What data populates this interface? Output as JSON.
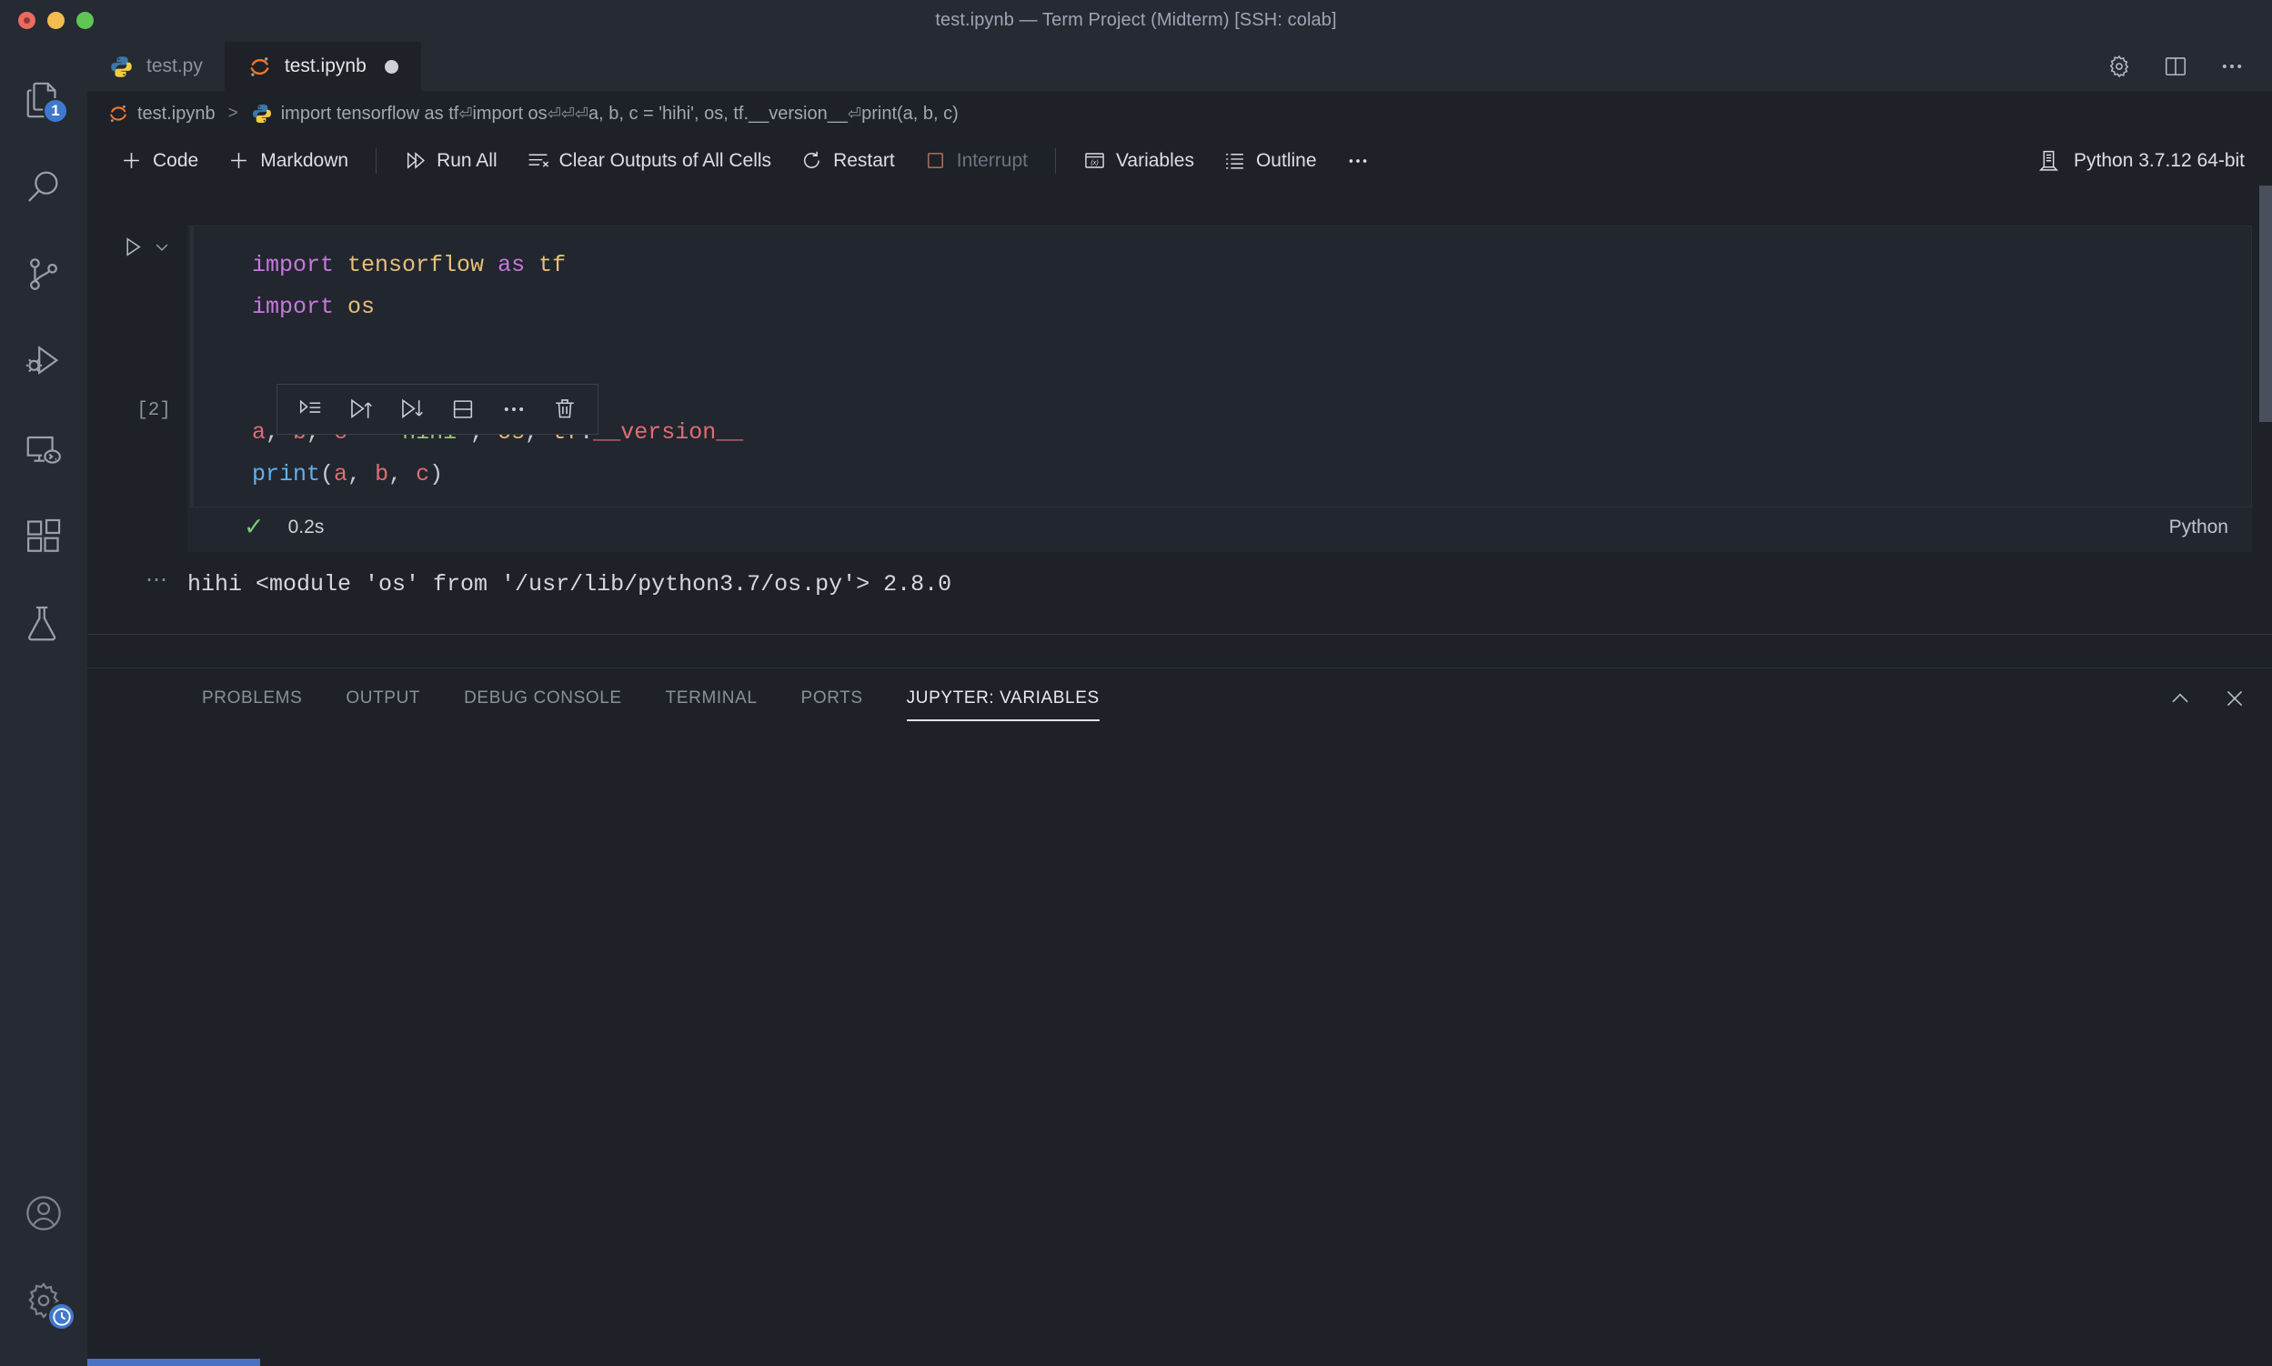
{
  "window": {
    "title": "test.ipynb — Term Project (Midterm) [SSH: colab]"
  },
  "activitybar": {
    "items": [
      {
        "name": "explorer",
        "icon": "files-icon",
        "badge": "1"
      },
      {
        "name": "search",
        "icon": "search-icon",
        "badge": ""
      },
      {
        "name": "source-control",
        "icon": "source-control-icon",
        "badge": ""
      },
      {
        "name": "run-and-debug",
        "icon": "debug-icon",
        "badge": ""
      },
      {
        "name": "remote-explorer",
        "icon": "remote-explorer-icon",
        "badge": ""
      },
      {
        "name": "extensions",
        "icon": "extensions-icon",
        "badge": ""
      },
      {
        "name": "testing",
        "icon": "beaker-icon",
        "badge": ""
      }
    ],
    "bottom": [
      {
        "name": "accounts",
        "icon": "account-icon"
      },
      {
        "name": "manage",
        "icon": "gear-icon",
        "badge_icon": "clock-icon"
      }
    ]
  },
  "tabs": [
    {
      "label": "test.py",
      "icon": "python-file-icon",
      "active": false,
      "dirty": false
    },
    {
      "label": "test.ipynb",
      "icon": "jupyter-file-icon",
      "active": true,
      "dirty": true
    }
  ],
  "tabbar_actions": [
    {
      "name": "notebook-settings",
      "icon": "gear-icon"
    },
    {
      "name": "split-editor",
      "icon": "split-editor-icon"
    },
    {
      "name": "more-actions",
      "icon": "ellipsis-icon"
    }
  ],
  "breadcrumb": {
    "file": "test.ipynb",
    "separator": ">",
    "cell_summary_parts": [
      "import tensorflow as tf",
      "import os",
      "",
      "",
      "a, b, c = 'hihi', os, tf.__version__",
      "print(a, b, c)"
    ],
    "return_glyph": "⏎"
  },
  "notebook_toolbar": {
    "buttons": [
      {
        "label": "Code",
        "icon": "plus-icon",
        "disabled": false
      },
      {
        "label": "Markdown",
        "icon": "plus-icon",
        "disabled": false
      },
      {
        "label": "Run All",
        "icon": "run-all-icon",
        "disabled": false
      },
      {
        "label": "Clear Outputs of All Cells",
        "icon": "clear-outputs-icon",
        "disabled": false
      },
      {
        "label": "Restart",
        "icon": "restart-icon",
        "disabled": false
      },
      {
        "label": "Interrupt",
        "icon": "stop-square-icon",
        "disabled": true
      },
      {
        "label": "Variables",
        "icon": "variables-icon",
        "disabled": false
      },
      {
        "label": "Outline",
        "icon": "outline-icon",
        "disabled": false
      },
      {
        "label": "…",
        "icon": "ellipsis-icon",
        "disabled": false
      }
    ],
    "kernel": {
      "label": "Python 3.7.12 64-bit",
      "icon": "kernel-icon"
    }
  },
  "cell_toolbar": {
    "buttons": [
      {
        "name": "run-by-line",
        "icon": "run-by-line-icon"
      },
      {
        "name": "run-above",
        "icon": "run-above-icon"
      },
      {
        "name": "run-below",
        "icon": "run-below-icon"
      },
      {
        "name": "split-cell",
        "icon": "split-cell-icon"
      },
      {
        "name": "more",
        "icon": "ellipsis-icon"
      },
      {
        "name": "delete-cell",
        "icon": "trash-icon"
      }
    ]
  },
  "cell": {
    "execution_count": "[2]",
    "run_icon": "play-icon",
    "collapse_icon": "chevron-down-icon",
    "status_icon": "check-icon",
    "elapsed": "0.2s",
    "language": "Python",
    "code_lines": [
      [
        {
          "t": "import",
          "c": "kw"
        },
        {
          "t": " ",
          "c": "pl"
        },
        {
          "t": "tensorflow",
          "c": "mod"
        },
        {
          "t": " ",
          "c": "pl"
        },
        {
          "t": "as",
          "c": "kw"
        },
        {
          "t": " ",
          "c": "pl"
        },
        {
          "t": "tf",
          "c": "mod"
        }
      ],
      [
        {
          "t": "import",
          "c": "kw"
        },
        {
          "t": " ",
          "c": "pl"
        },
        {
          "t": "os",
          "c": "mod"
        }
      ],
      [],
      [],
      [
        {
          "t": "a",
          "c": "var"
        },
        {
          "t": ", ",
          "c": "pl"
        },
        {
          "t": "b",
          "c": "var"
        },
        {
          "t": ", ",
          "c": "pl"
        },
        {
          "t": "c",
          "c": "var"
        },
        {
          "t": " ",
          "c": "pl"
        },
        {
          "t": "=",
          "c": "op"
        },
        {
          "t": " ",
          "c": "pl"
        },
        {
          "t": "'hihi'",
          "c": "str"
        },
        {
          "t": ", ",
          "c": "pl"
        },
        {
          "t": "os",
          "c": "mod"
        },
        {
          "t": ", ",
          "c": "pl"
        },
        {
          "t": "tf",
          "c": "mod"
        },
        {
          "t": ".",
          "c": "pl"
        },
        {
          "t": "__version__",
          "c": "var"
        }
      ],
      [
        {
          "t": "print",
          "c": "fn"
        },
        {
          "t": "(",
          "c": "pl"
        },
        {
          "t": "a",
          "c": "var"
        },
        {
          "t": ", ",
          "c": "pl"
        },
        {
          "t": "b",
          "c": "var"
        },
        {
          "t": ", ",
          "c": "pl"
        },
        {
          "t": "c",
          "c": "var"
        },
        {
          "t": ")",
          "c": "pl"
        }
      ]
    ],
    "output_dots": "⋯",
    "output_text": "hihi <module 'os' from '/usr/lib/python3.7/os.py'> 2.8.0"
  },
  "panel": {
    "tabs": [
      {
        "label": "PROBLEMS",
        "active": false
      },
      {
        "label": "OUTPUT",
        "active": false
      },
      {
        "label": "DEBUG CONSOLE",
        "active": false
      },
      {
        "label": "TERMINAL",
        "active": false
      },
      {
        "label": "PORTS",
        "active": false
      },
      {
        "label": "JUPYTER: VARIABLES",
        "active": true
      }
    ],
    "actions": [
      {
        "name": "maximize-panel",
        "icon": "chevron-up-icon"
      },
      {
        "name": "close-panel",
        "icon": "close-icon"
      }
    ]
  },
  "colors": {
    "accent": "#3f79cd",
    "remote": "#4a72c4",
    "success": "#7ec87e",
    "editor_bg": "#1e2127",
    "chrome_bg": "#252a33",
    "cell_bg": "#22262e"
  }
}
